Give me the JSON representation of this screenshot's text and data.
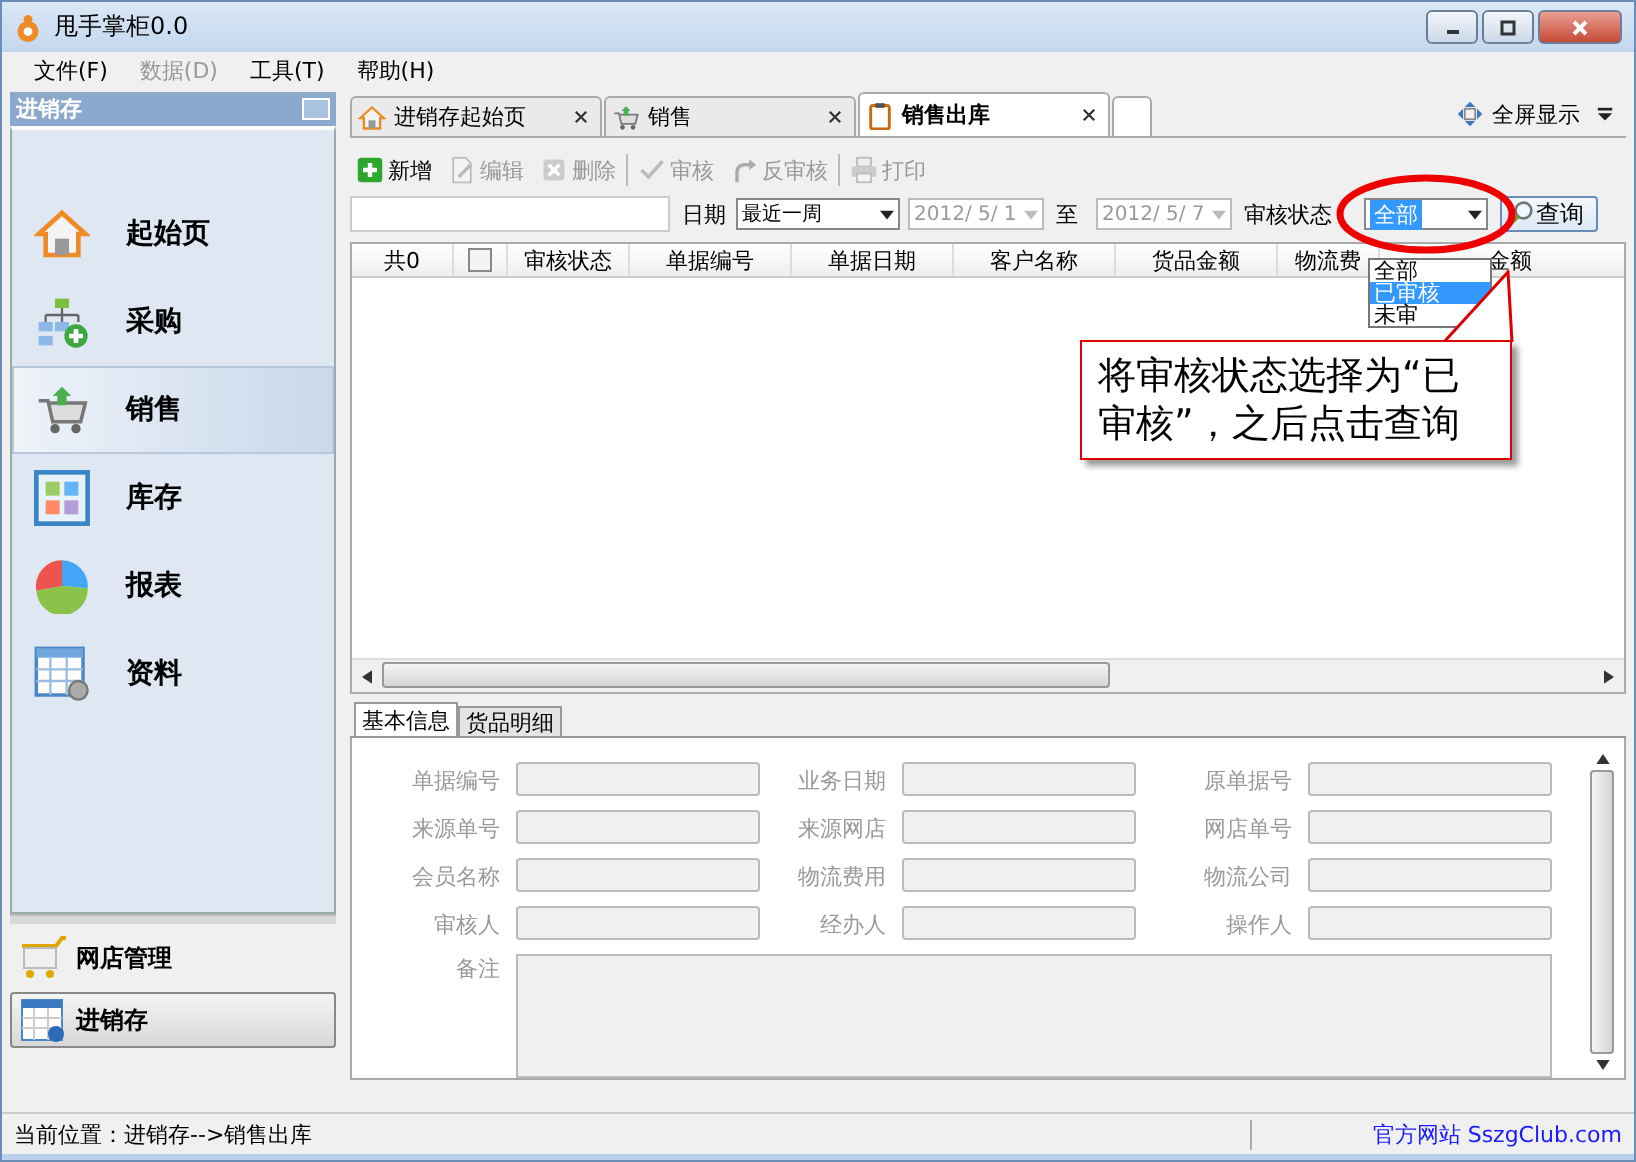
{
  "window": {
    "title": "甩手掌柜0.0"
  },
  "menu": [
    {
      "label": "文件(F)",
      "disabled": false
    },
    {
      "label": "数据(D)",
      "disabled": true
    },
    {
      "label": "工具(T)",
      "disabled": false
    },
    {
      "label": "帮助(H)",
      "disabled": false
    }
  ],
  "sidebar": {
    "title": "进销存",
    "items": [
      {
        "label": "起始页",
        "kind": "home",
        "selected": false
      },
      {
        "label": "采购",
        "kind": "purchase",
        "selected": false
      },
      {
        "label": "销售",
        "kind": "sales",
        "selected": true
      },
      {
        "label": "库存",
        "kind": "stock",
        "selected": false
      },
      {
        "label": "报表",
        "kind": "report",
        "selected": false
      },
      {
        "label": "资料",
        "kind": "data",
        "selected": false
      }
    ]
  },
  "sidebar_sections": [
    {
      "label": "网店管理",
      "kind": "shop",
      "selected": false
    },
    {
      "label": "进销存",
      "kind": "inventory",
      "selected": true
    }
  ],
  "tabs": [
    {
      "label": "进销存起始页",
      "kind": "home",
      "selected": false
    },
    {
      "label": "销售",
      "kind": "sales",
      "selected": false
    },
    {
      "label": "销售出库",
      "kind": "doc",
      "selected": true
    }
  ],
  "fullscreen": "全屏显示",
  "toolbar": [
    {
      "label": "新增",
      "kind": "add",
      "disabled": false
    },
    {
      "label": "编辑",
      "kind": "edit",
      "disabled": true
    },
    {
      "label": "删除",
      "kind": "delete",
      "disabled": true
    },
    {
      "label": "审核",
      "kind": "approve",
      "disabled": true
    },
    {
      "label": "反审核",
      "kind": "unapprove",
      "disabled": true
    },
    {
      "label": "打印",
      "kind": "print",
      "disabled": true
    }
  ],
  "filter": {
    "date_label": "日期",
    "period": "最近一周",
    "from": "2012/ 5/ 1",
    "to_label": "至",
    "to": "2012/ 5/ 7",
    "status_label": "审核状态",
    "status": "全部",
    "query": "查询"
  },
  "status_dropdown": [
    {
      "label": "全部",
      "selected": false
    },
    {
      "label": "已审核",
      "selected": true
    },
    {
      "label": "未审",
      "selected": false
    }
  ],
  "table": {
    "count": "共0",
    "select_all_checked": false,
    "columns": [
      "审核状态",
      "单据编号",
      "单据日期",
      "客户名称",
      "货品金额",
      "物流费",
      "金额"
    ]
  },
  "detail_tabs": [
    {
      "label": "基本信息",
      "selected": true
    },
    {
      "label": "货品明细",
      "selected": false
    }
  ],
  "form": {
    "fields": [
      "单据编号",
      "业务日期",
      "原单据号",
      "来源单号",
      "来源网店",
      "网店单号",
      "会员名称",
      "物流费用",
      "物流公司",
      "审核人",
      "经办人",
      "操作人"
    ],
    "remark_label": "备注"
  },
  "callout": "将审核状态选择为“已审核”，之后点击查询",
  "status_bar": {
    "location": "当前位置：进销存-->销售出库",
    "website": "官方网站 SszgClub.com"
  }
}
